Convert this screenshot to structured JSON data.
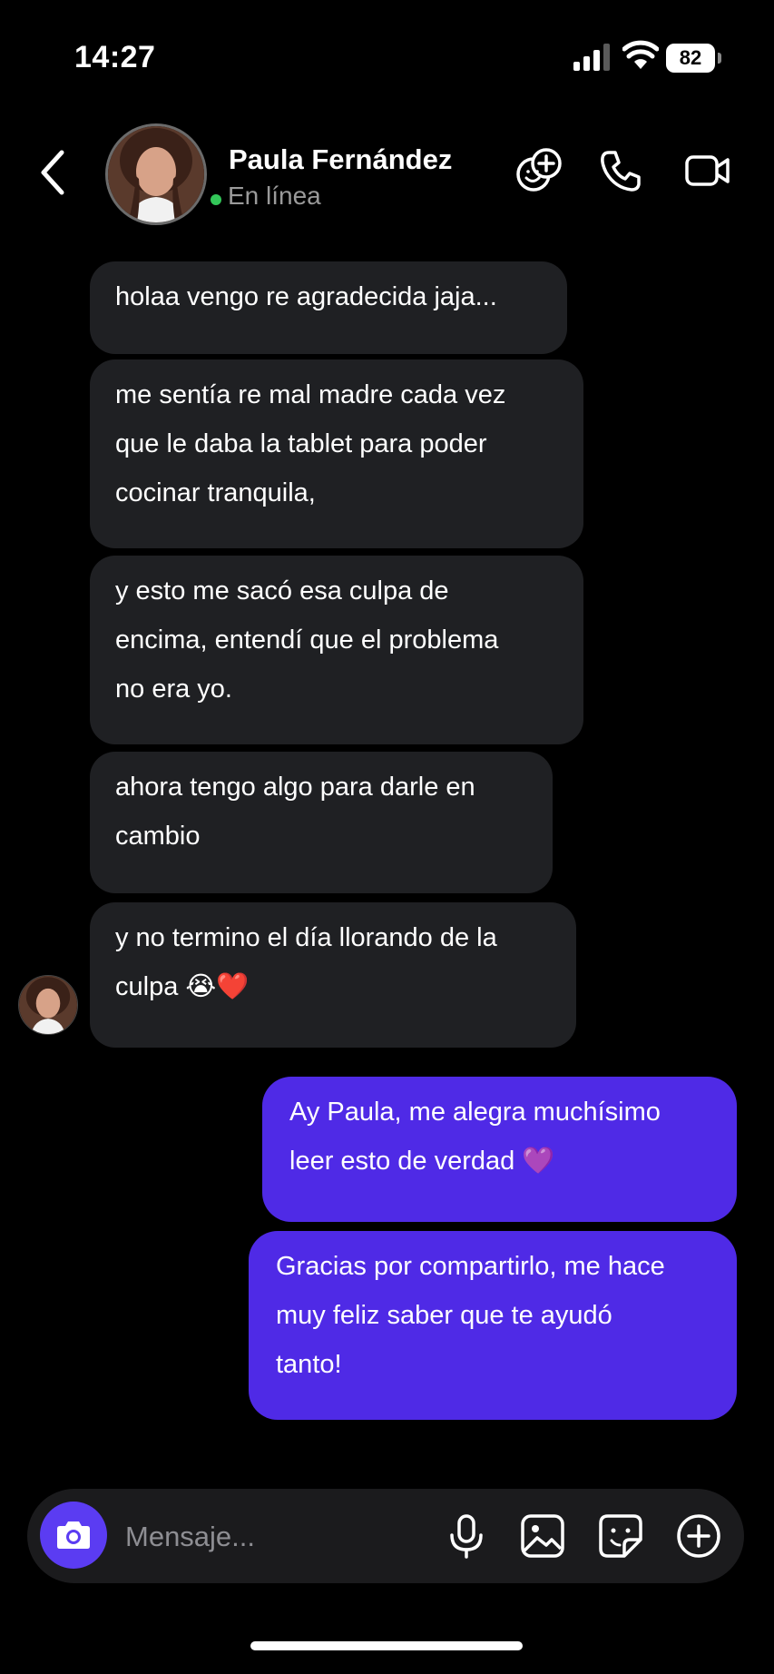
{
  "status_bar": {
    "time": "14:27",
    "battery": "82"
  },
  "header": {
    "contact_name": "Paula Fernández",
    "status": "En línea"
  },
  "messages": [
    {
      "direction": "incoming",
      "lines": [
        "holaa vengo re agradecida jaja..."
      ]
    },
    {
      "direction": "incoming",
      "lines": [
        "me sentía re mal madre cada vez",
        "que le daba la tablet para poder",
        "cocinar tranquila,"
      ]
    },
    {
      "direction": "incoming",
      "lines": [
        "y esto me sacó esa culpa de",
        "encima, entendí que el problema",
        "no era yo."
      ]
    },
    {
      "direction": "incoming",
      "lines": [
        "ahora tengo algo para darle en",
        "cambio"
      ]
    },
    {
      "direction": "incoming",
      "lines": [
        "y no termino el día llorando de la",
        "culpa 😭❤️"
      ]
    },
    {
      "direction": "outgoing",
      "lines": [
        "Ay Paula, me alegra muchísimo",
        "leer esto de verdad 💜"
      ]
    },
    {
      "direction": "outgoing",
      "lines": [
        "Gracias por compartirlo, me hace",
        "muy feliz saber que te ayudó",
        "tanto!"
      ]
    }
  ],
  "composer": {
    "placeholder": "Mensaje..."
  },
  "colors": {
    "background": "#000000",
    "incoming_bubble": "#1f2023",
    "outgoing_bubble": "#4f2ae6",
    "camera_button": "#5b3cf2",
    "online": "#33c759"
  },
  "icons": [
    "back-chevron-icon",
    "add-people-icon",
    "phone-icon",
    "video-camera-icon",
    "camera-icon",
    "microphone-icon",
    "gallery-icon",
    "sticker-icon",
    "plus-circle-icon"
  ]
}
